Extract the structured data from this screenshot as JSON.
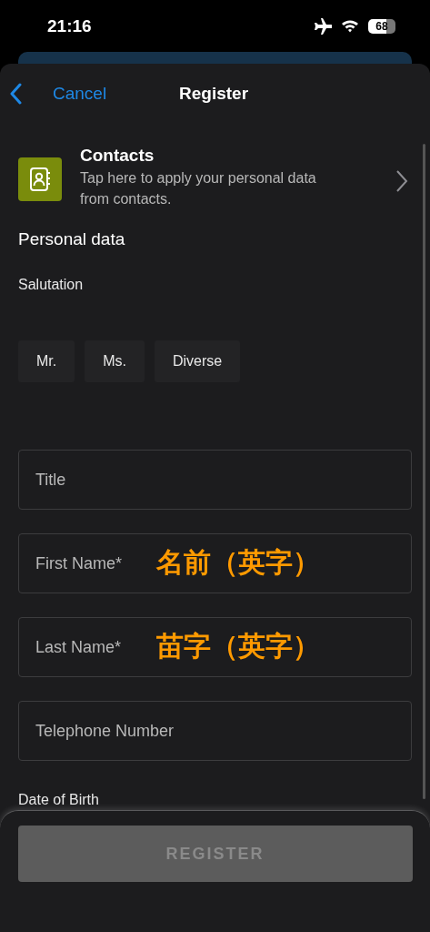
{
  "status_bar": {
    "time": "21:16",
    "battery": "68"
  },
  "nav": {
    "back": "Cancel",
    "title": "Register"
  },
  "contacts": {
    "title": "Contacts",
    "description": "Tap here to apply your personal data from contacts."
  },
  "section": "Personal data",
  "salutation": {
    "label": "Salutation",
    "options": [
      {
        "label": "Mr.",
        "selected": false
      },
      {
        "label": "Ms.",
        "selected": false
      },
      {
        "label": "Diverse",
        "selected": false
      }
    ]
  },
  "fields": [
    {
      "placeholder": "Title"
    },
    {
      "placeholder": "First Name*",
      "annotation": "名前（英字）"
    },
    {
      "placeholder": "Last Name*",
      "annotation": "苗字（英字）"
    },
    {
      "placeholder": "Telephone Number"
    }
  ],
  "next_label": "Date of Birth",
  "register_button": {
    "label": "REGISTER",
    "disabled": true
  }
}
